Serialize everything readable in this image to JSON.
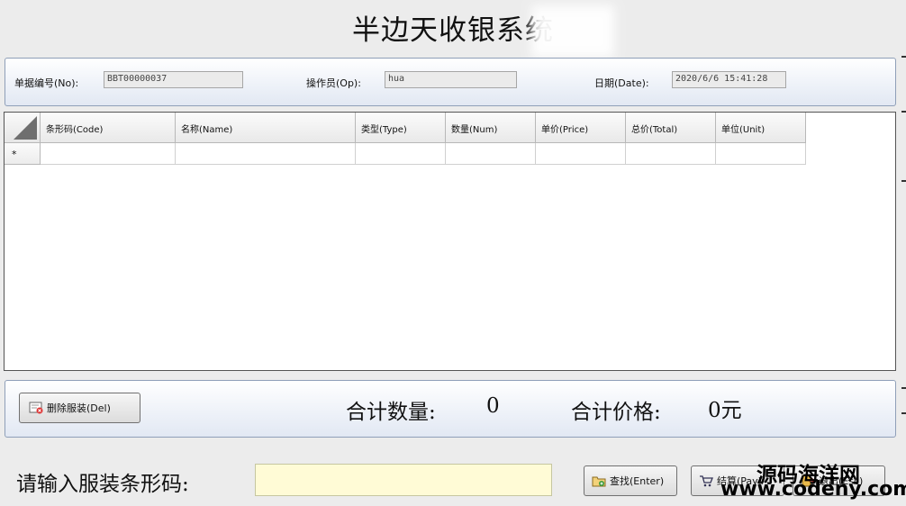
{
  "title": "半边天收银系统",
  "header": {
    "no_label": "单据编号(No):",
    "no_value": "BBT00000037",
    "op_label": "操作员(Op):",
    "op_value": "hua",
    "date_label": "日期(Date):",
    "date_value": "2020/6/6 15:41:28"
  },
  "grid": {
    "columns": [
      "条形码(Code)",
      "名称(Name)",
      "类型(Type)",
      "数量(Num)",
      "单价(Price)",
      "总价(Total)",
      "单位(Unit)"
    ],
    "new_row_marker": "*"
  },
  "summary": {
    "delete_button": "删除服装(Del)",
    "qty_label": "合计数量:",
    "qty_value": "0",
    "price_label": "合计价格:",
    "price_value": "0元"
  },
  "footer": {
    "barcode_label": "请输入服装条形码:",
    "barcode_value": "",
    "find_button": "查找(Enter)",
    "checkout_button": "结算(Pay)",
    "exit_button": "退出(Esc)"
  },
  "watermark": {
    "line1": "源码海洋网",
    "line2": "www.codeny.com"
  }
}
